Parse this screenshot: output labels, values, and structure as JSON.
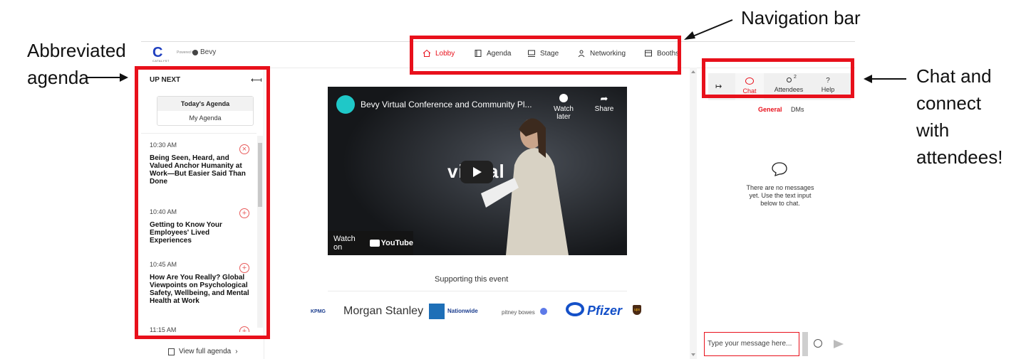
{
  "callouts": {
    "abbreviated_agenda": [
      "Abbreviated",
      "agenda"
    ],
    "navigation_bar": "Navigation bar",
    "chat_connect": [
      "Chat and",
      "connect",
      "with",
      "attendees!"
    ]
  },
  "header": {
    "logo_text": "CATALYST",
    "powered_by": "Powered by",
    "brand": "Bevy",
    "nav": [
      {
        "label": "Lobby",
        "icon": "home-icon",
        "active": true
      },
      {
        "label": "Agenda",
        "icon": "agenda-icon",
        "active": false
      },
      {
        "label": "Stage",
        "icon": "stage-icon",
        "active": false
      },
      {
        "label": "Networking",
        "icon": "networking-icon",
        "active": false
      },
      {
        "label": "Booths",
        "icon": "booths-icon",
        "active": false
      }
    ]
  },
  "agenda": {
    "heading": "UP NEXT",
    "collapse_icon": "collapse-left-icon",
    "tab_today": "Today's Agenda",
    "tab_my": "My Agenda",
    "items": [
      {
        "time": "10:30 AM",
        "title": "Being Seen, Heard, and Valued Anchor Humanity at Work—But Easier Said Than Done",
        "action": "×"
      },
      {
        "time": "10:40 AM",
        "title": "Getting to Know Your Employees' Lived Experiences",
        "action": "+"
      },
      {
        "time": "10:45 AM",
        "title": "How Are You Really? Global Viewpoints on Psychological Safety, Wellbeing, and Mental Health at Work",
        "action": "+"
      },
      {
        "time": "11:15 AM",
        "title": "",
        "action": "+"
      }
    ],
    "view_full": "View full agenda",
    "view_full_arrow": "›"
  },
  "video": {
    "title": "Bevy Virtual Conference and Community Pl...",
    "watch_later": "Watch later",
    "share": "Share",
    "overlay_text": "vi  ual",
    "watch_on": "Watch on",
    "youtube": "YouTube"
  },
  "supporting": {
    "heading": "Supporting this event",
    "logos": [
      "KPMG",
      "Morgan Stanley",
      "Nationwide",
      "pitney bowes",
      "Pfizer",
      "ups"
    ]
  },
  "chat": {
    "expand_icon": "↦",
    "tabs": [
      {
        "label": "Chat",
        "icon": "chat-icon",
        "active": true
      },
      {
        "label": "Attendees",
        "icon": "attendees-icon",
        "badge": "2",
        "active": false
      },
      {
        "label": "Help",
        "icon": "help-icon",
        "active": false
      }
    ],
    "sub_general": "General",
    "sub_dms": "DMs",
    "empty_message": [
      "There are no messages",
      "yet. Use the text input",
      "below to chat."
    ],
    "input_placeholder": "Type your message here...",
    "accent": "#e8101b"
  }
}
